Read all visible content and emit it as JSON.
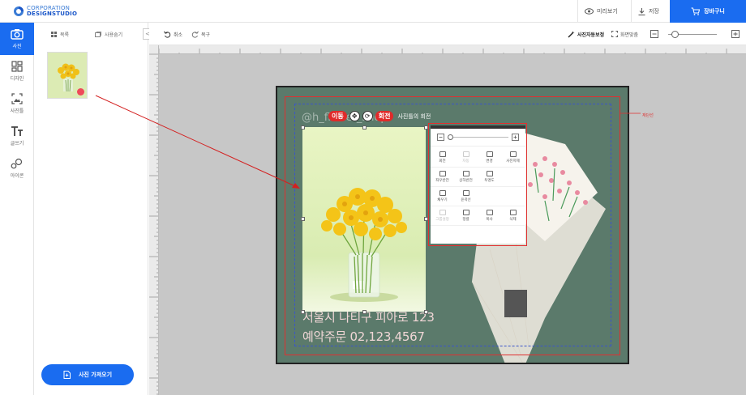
{
  "logo": {
    "line1": "CORPORATION",
    "line2": "DESIGNSTUDIO"
  },
  "topbar": {
    "preview": "미리보기",
    "save": "저장",
    "cart": "장바구니"
  },
  "rail": [
    {
      "label": "사진",
      "icon": "camera-icon",
      "active": true
    },
    {
      "label": "디자인",
      "icon": "layout-icon",
      "active": false
    },
    {
      "label": "사진틀",
      "icon": "frame-icon",
      "active": false
    },
    {
      "label": "글쓰기",
      "icon": "text-icon",
      "active": false
    },
    {
      "label": "아이콘",
      "icon": "shapes-icon",
      "active": false
    }
  ],
  "panel": {
    "list_label": "목록",
    "hide_used": "사용숨기",
    "collapse": "<",
    "import_button": "사진 가져오기"
  },
  "workbar": {
    "undo": "취소",
    "redo": "복구",
    "auto_correct": "사진자동보정",
    "fit_screen": "화면맞춤"
  },
  "canvas": {
    "guide_label": "재단선",
    "handle_text": "@h_flower_shop",
    "address": "서울시 나티구 피아로 123",
    "phone": "예약주문 02,123,4567"
  },
  "control_bar": {
    "move": "이동",
    "rotate": "회전",
    "label": "사진틀의 회전"
  },
  "context_menu": {
    "items": [
      {
        "label": "회전",
        "disabled": false
      },
      {
        "label": "자동",
        "disabled": true
      },
      {
        "label": "변경",
        "disabled": false
      },
      {
        "label": "사진지제",
        "disabled": false
      },
      {
        "label": "좌우반전",
        "disabled": false
      },
      {
        "label": "상하반전",
        "disabled": false
      },
      {
        "label": "투명도",
        "disabled": false
      },
      {
        "label": "",
        "disabled": true
      },
      {
        "label": "채우기",
        "disabled": false
      },
      {
        "label": "윤곽선",
        "disabled": false
      },
      {
        "label": "",
        "disabled": true
      },
      {
        "label": "",
        "disabled": true
      },
      {
        "label": "그룹설정",
        "disabled": true
      },
      {
        "label": "정렬",
        "disabled": false
      },
      {
        "label": "복사",
        "disabled": false
      },
      {
        "label": "삭제",
        "disabled": false
      }
    ]
  }
}
